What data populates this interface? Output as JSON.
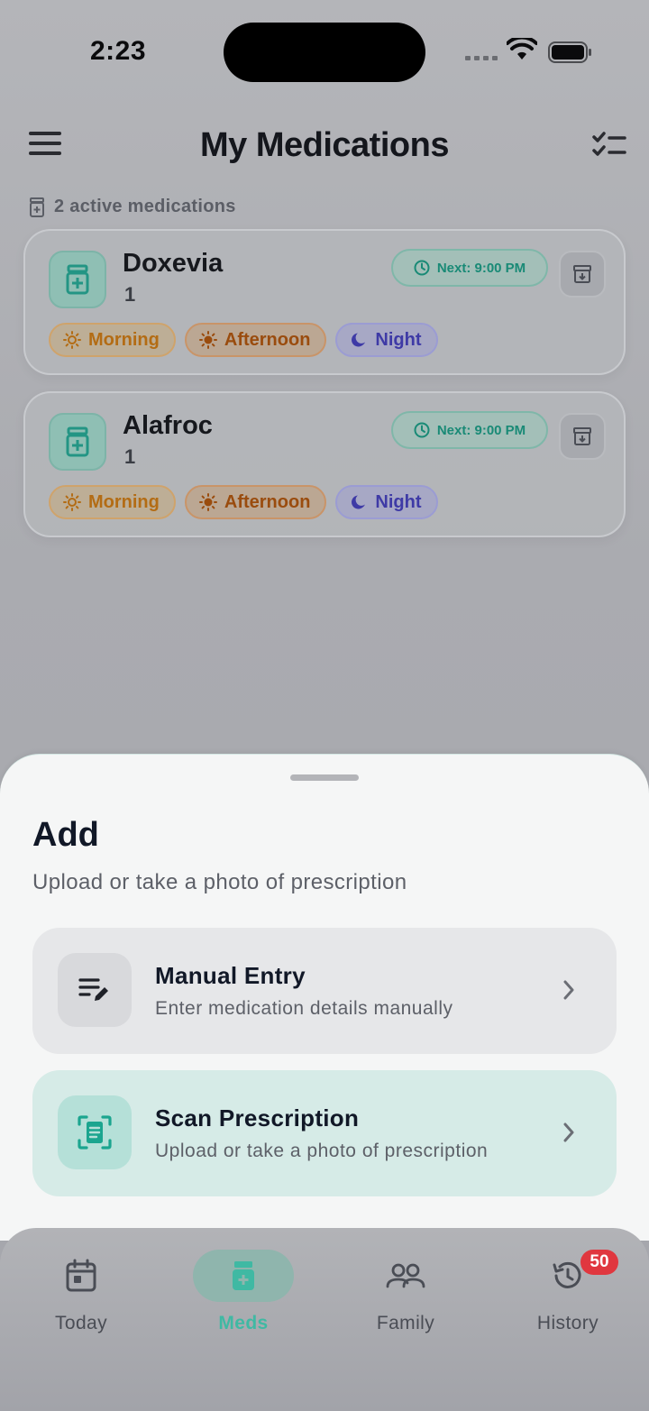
{
  "status_bar": {
    "time": "2:23"
  },
  "header": {
    "title": "My Medications"
  },
  "summary": {
    "active_count_text": "2 active medications"
  },
  "medications": [
    {
      "name": "Doxevia",
      "dose": "1",
      "next": "Next: 9:00 PM",
      "schedule": [
        "Morning",
        "Afternoon",
        "Night"
      ]
    },
    {
      "name": "Alafroc",
      "dose": "1",
      "next": "Next: 9:00 PM",
      "schedule": [
        "Morning",
        "Afternoon",
        "Night"
      ]
    }
  ],
  "sheet": {
    "title": "Add",
    "subtitle": "Upload or take a photo of prescription",
    "options": [
      {
        "title": "Manual Entry",
        "description": "Enter medication details manually",
        "icon": "edit-list-icon"
      },
      {
        "title": "Scan Prescription",
        "description": "Upload or take a photo of prescription",
        "icon": "scan-document-icon"
      }
    ]
  },
  "tabbar": {
    "tabs": [
      {
        "label": "Today",
        "icon": "calendar-icon"
      },
      {
        "label": "Meds",
        "icon": "pill-bottle-icon",
        "active": true
      },
      {
        "label": "Family",
        "icon": "people-icon"
      },
      {
        "label": "History",
        "icon": "history-icon",
        "badge": "50"
      }
    ]
  },
  "colors": {
    "accent": "#3fb9a3",
    "morning": "#b36c14",
    "afternoon": "#9a4c0e",
    "night": "#3e3aa6",
    "badge": "#e0373f"
  }
}
